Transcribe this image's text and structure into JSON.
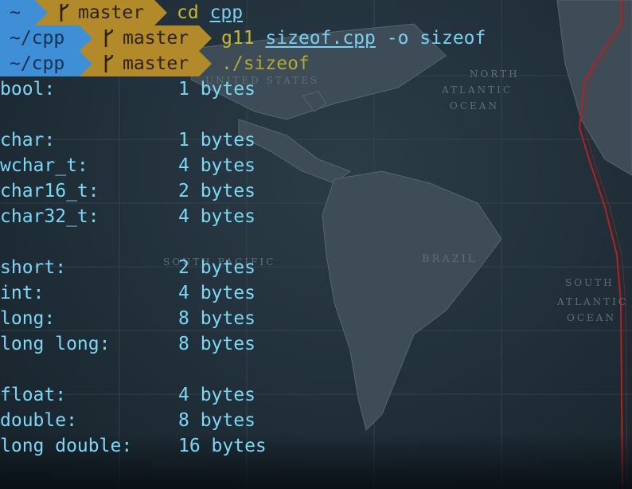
{
  "prompts": [
    {
      "dir": "~",
      "branch": "master",
      "command": "cd",
      "args": "cpp"
    },
    {
      "dir": "~/cpp",
      "branch": "master",
      "command": "g11",
      "args": "sizeof.cpp",
      "rest": "-o sizeof"
    },
    {
      "dir": "~/cpp",
      "branch": "master",
      "command": "./sizeof"
    }
  ],
  "output": [
    {
      "name": "bool:",
      "value": "1 bytes"
    },
    {
      "name": "",
      "value": ""
    },
    {
      "name": "char:",
      "value": "1 bytes"
    },
    {
      "name": "wchar_t:",
      "value": "4 bytes"
    },
    {
      "name": "char16_t:",
      "value": "2 bytes"
    },
    {
      "name": "char32_t:",
      "value": "4 bytes"
    },
    {
      "name": "",
      "value": ""
    },
    {
      "name": "short:",
      "value": "2 bytes"
    },
    {
      "name": "int:",
      "value": "4 bytes"
    },
    {
      "name": "long:",
      "value": "8 bytes"
    },
    {
      "name": "long long:",
      "value": "8 bytes"
    },
    {
      "name": "",
      "value": ""
    },
    {
      "name": "float:",
      "value": "4 bytes"
    },
    {
      "name": "double:",
      "value": "8 bytes"
    },
    {
      "name": "long double:",
      "value": "16 bytes"
    }
  ],
  "background": {
    "labels": [
      "UNITED STATES",
      "NORTH",
      "ATLANTIC",
      "OCEAN",
      "BRAZIL",
      "SOUTH",
      "ATLANTIC",
      "OCEAN",
      "SOUTH PACIFIC"
    ]
  },
  "colors": {
    "dir_segment": "#3f8fd6",
    "git_segment": "#b38a2a",
    "output_text": "#7cd7f7",
    "command_text": "#c6b832"
  }
}
